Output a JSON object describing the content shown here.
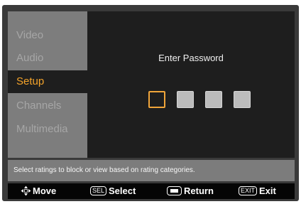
{
  "menu": {
    "items": [
      {
        "label": "Video"
      },
      {
        "label": "Audio"
      },
      {
        "label": "Setup"
      },
      {
        "label": "Channels"
      },
      {
        "label": "Multimedia"
      }
    ],
    "active_index": 2
  },
  "password": {
    "prompt": "Enter Password",
    "digits_total": 4,
    "focused_index": 0
  },
  "help_text": "Select ratings to block or view based on rating categories.",
  "footer": {
    "move": {
      "icon": "four-way-arrows-icon",
      "label": "Move"
    },
    "select": {
      "key": "SEL",
      "label": "Select"
    },
    "return": {
      "icon": "return-key-icon",
      "label": "Return"
    },
    "exit": {
      "key": "EXIT",
      "label": "Exit"
    }
  },
  "colors": {
    "accent": "#f4a32a",
    "sidebar": "#7d7d7d",
    "panel": "#1e1e1e"
  }
}
